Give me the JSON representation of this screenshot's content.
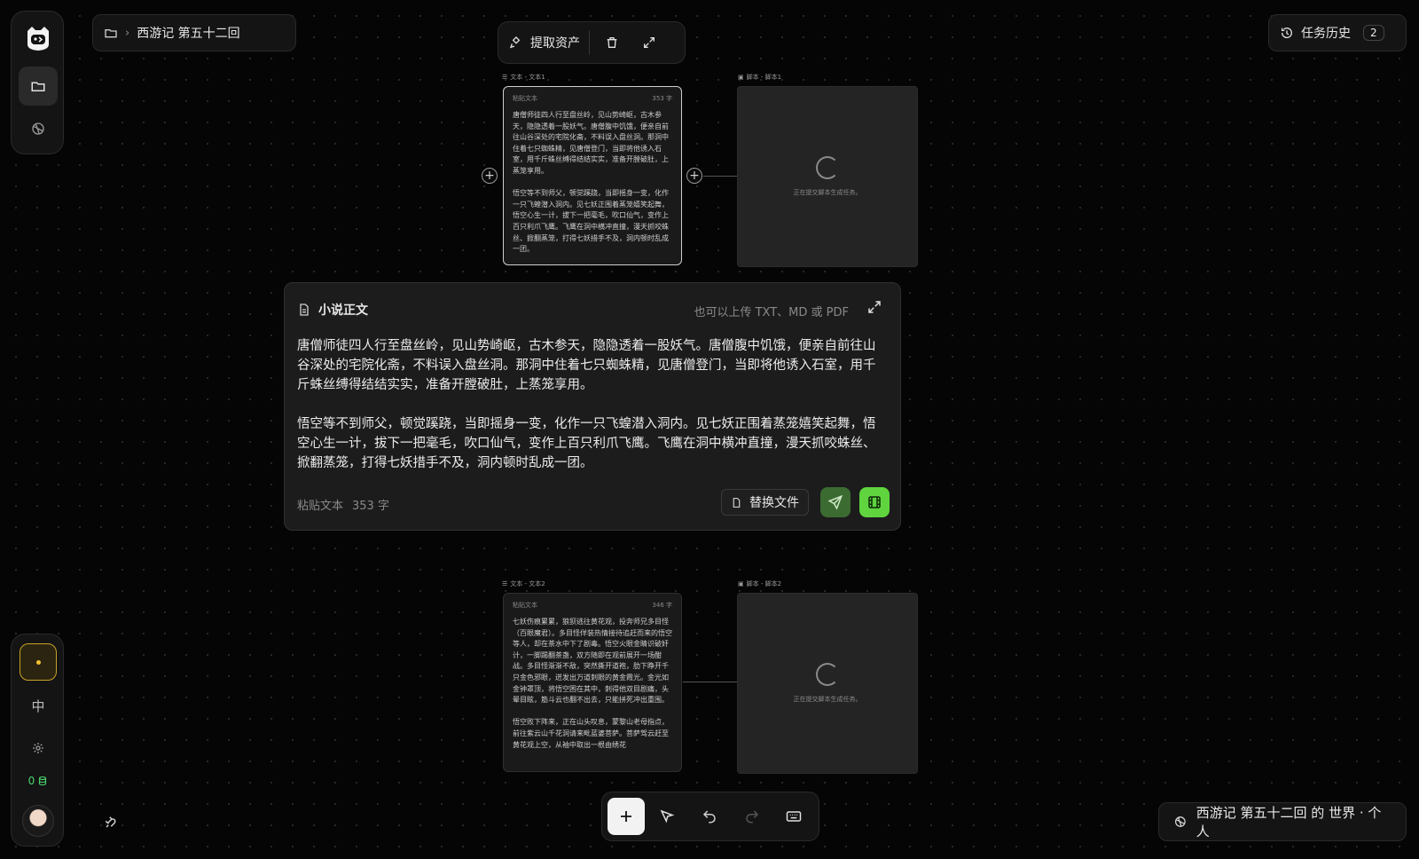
{
  "breadcrumb": {
    "title": "西游记 第五十二回"
  },
  "node_toolbar": {
    "extract_label": "提取资产"
  },
  "history": {
    "label": "任务历史",
    "count": "2"
  },
  "nodes": {
    "text1": {
      "label": "文本 - 文本1",
      "source": "粘贴文本",
      "count": "353 字",
      "body": "唐僧师徒四人行至盘丝岭，见山势崎岖，古木参天，隐隐透着一股妖气。唐僧腹中饥饿，便亲自前往山谷深处的宅院化斋，不料误入盘丝洞。那洞中住着七只蜘蛛精，见唐僧登门，当即将他诱入石室，用千斤蛛丝缚得结结实实，准备开膛破肚，上蒸笼享用。\n\n悟空等不到师父，顿觉蹊跷，当即摇身一变，化作一只飞蝗潜入洞内。见七妖正围着蒸笼嬉笑起舞，悟空心生一计，拔下一把毫毛，吹口仙气，变作上百只利爪飞鹰。飞鹰在洞中横冲直撞，漫天抓咬蛛丝、掀翻蒸笼，打得七妖措手不及，洞内顿时乱成一团。"
    },
    "script1": {
      "label": "脚本 - 脚本1",
      "status": "正在提交脚本生成任务。"
    },
    "text2": {
      "label": "文本 - 文本2",
      "source": "粘贴文本",
      "count": "346 字",
      "body": "七妖伤痕累累，狼狈逃往黄花观，投奔师兄多目怪（百眼魔君）。多目怪佯装热情接待追赶而来的悟空等人，却在茶水中下了剧毒。悟空火眼金睛识破奸计，一脚踢翻茶盏，双方随即在观前展开一场酣战。多目怪渐渐不敌，突然撕开道袍，肋下睁开千只金色邪眼，迸发出万道刺眼的黄金霞光。金光如金钟罩顶，将悟空困在其中，刺得他双目剧痛，头晕目眩，筋斗云也翻不出去，只能拼死冲出重围。\n\n悟空败下阵来，正在山头叹息，蒙黎山老母指点，前往紫云山千花洞请来毗蓝婆菩萨。菩萨驾云赶至黄花观上空，从袖中取出一根由绣花"
    },
    "script2": {
      "label": "脚本 - 脚本2",
      "status": "正在提交脚本生成任务。"
    }
  },
  "editor": {
    "title": "小说正文",
    "hint": "也可以上传 TXT、MD 或 PDF",
    "content": "唐僧师徒四人行至盘丝岭，见山势崎岖，古木参天，隐隐透着一股妖气。唐僧腹中饥饿，便亲自前往山谷深处的宅院化斋，不料误入盘丝洞。那洞中住着七只蜘蛛精，见唐僧登门，当即将他诱入石室，用千斤蛛丝缚得结结实实，准备开膛破肚，上蒸笼享用。\n\n悟空等不到师父，顿觉蹊跷，当即摇身一变，化作一只飞蝗潜入洞内。见七妖正围着蒸笼嬉笑起舞，悟空心生一计，拔下一把毫毛，吹口仙气，变作上百只利爪飞鹰。飞鹰在洞中横冲直撞，漫天抓咬蛛丝、掀翻蒸笼，打得七妖措手不及，洞内顿时乱成一团。",
    "source": "粘贴文本",
    "count": "353 字",
    "replace_label": "替换文件"
  },
  "sidebar": {
    "lang": "中",
    "credits": "0"
  },
  "world": {
    "label": "西游记 第五十二回 的 世界 · 个人"
  },
  "colors": {
    "accent_green": "#5fd43e",
    "status_yellow": "#f2c230"
  }
}
